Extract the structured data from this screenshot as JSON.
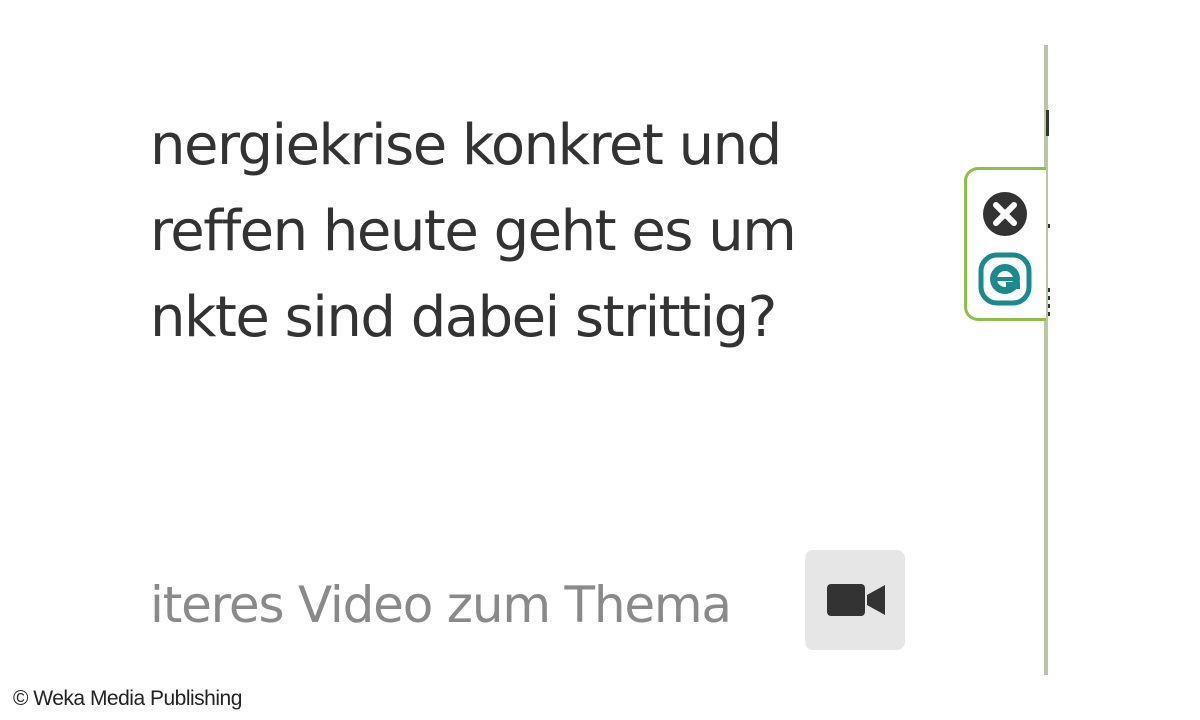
{
  "article": {
    "lines": [
      "nergiekrise konkret und",
      "reffen heute geht es um",
      "nkte sind dabei strittig?"
    ]
  },
  "video_link": {
    "label": "iteres Video zum Thema",
    "icon": "video-camera-icon"
  },
  "extension_widget": {
    "close_icon": "close-circle-icon",
    "logo_icon": "eset-e-logo-icon",
    "border_color": "#8cc04b",
    "logo_color": "#1a8a8e"
  },
  "watermark": {
    "text": "© Weka Media Publishing"
  }
}
